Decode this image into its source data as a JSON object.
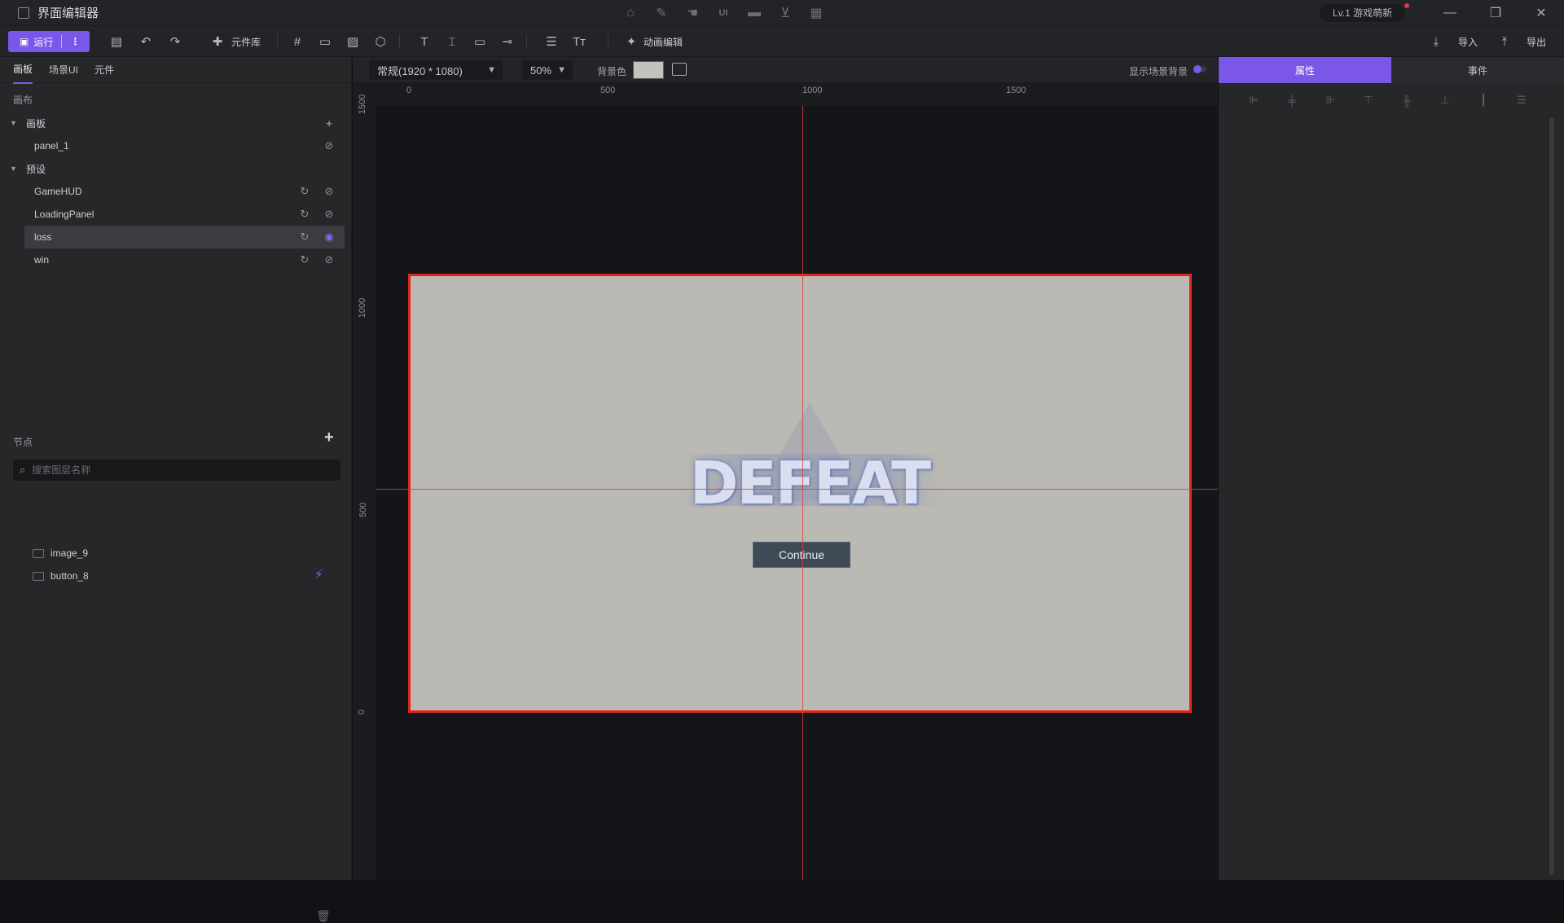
{
  "window": {
    "title": "界面编辑器",
    "level_badge": "Lv.1 游戏萌新",
    "center_icons": [
      "home-icon",
      "edit-icon",
      "hand-icon",
      "ui-icon",
      "folder-icon",
      "cart-icon",
      "grid-icon"
    ]
  },
  "toolbar": {
    "run_label": "运行",
    "component_lib_label": "元件库",
    "anim_edit_label": "动画编辑",
    "import_label": "导入",
    "export_label": "导出"
  },
  "left": {
    "tabs": [
      "画板",
      "场景UI",
      "元件"
    ],
    "canvas_section": "画布",
    "artboard_group": "画板",
    "artboard_items": [
      "panel_1"
    ],
    "preset_group": "预设",
    "preset_items": [
      "GameHUD",
      "LoadingPanel",
      "loss",
      "win"
    ],
    "selected_preset": "loss",
    "nodes_label": "节点",
    "search_placeholder": "搜索图层名称",
    "nodes": [
      "image_9",
      "button_8"
    ]
  },
  "canvas": {
    "resolution": "常规(1920 * 1080)",
    "zoom": "50%",
    "bg_label": "背景色",
    "bg_color": "#c4c2bd",
    "show_scene_bg_label": "显示场景背景",
    "ruler_top": [
      "0",
      "500",
      "1000",
      "1500"
    ],
    "ruler_left": [
      "1500",
      "1000",
      "500",
      "0"
    ],
    "defeat_text": "DEFEAT",
    "continue_label": "Continue"
  },
  "right": {
    "tabs": [
      "属性",
      "事件"
    ],
    "align_icons": [
      "align-left-icon",
      "align-hcenter-icon",
      "align-right-icon",
      "align-top-icon",
      "align-vcenter-icon",
      "align-bottom-icon",
      "distribute-h-icon",
      "distribute-v-icon"
    ]
  },
  "colors": {
    "accent": "#7b57e8",
    "selection": "#e0261a",
    "stage_bg": "#bab9b3"
  }
}
